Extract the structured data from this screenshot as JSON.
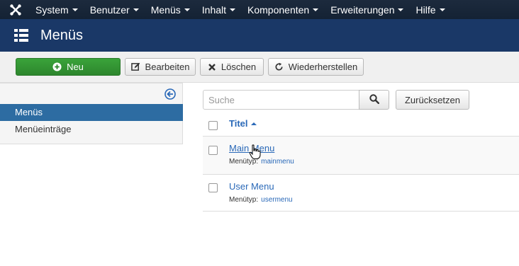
{
  "navbar": {
    "logo_icon": "joomla-logo-icon",
    "items": [
      {
        "label": "System"
      },
      {
        "label": "Benutzer"
      },
      {
        "label": "Menüs"
      },
      {
        "label": "Inhalt"
      },
      {
        "label": "Komponenten"
      },
      {
        "label": "Erweiterungen"
      },
      {
        "label": "Hilfe"
      }
    ]
  },
  "header": {
    "icon": "list-icon",
    "title": "Menüs"
  },
  "toolbar": {
    "new_label": "Neu",
    "edit_label": "Bearbeiten",
    "delete_label": "Löschen",
    "restore_label": "Wiederherstellen"
  },
  "sidebar": {
    "items": [
      {
        "label": "Menüs",
        "active": true
      },
      {
        "label": "Menüeinträge",
        "active": false
      }
    ]
  },
  "search": {
    "placeholder": "Suche",
    "value": "",
    "reset_label": "Zurücksetzen"
  },
  "table": {
    "title_header": "Titel",
    "rows": [
      {
        "title": "Main Menu",
        "type_label": "Menütyp:",
        "type_value": "mainmenu"
      },
      {
        "title": "User Menu",
        "type_label": "Menütyp:",
        "type_value": "usermenu"
      }
    ]
  },
  "colors": {
    "navbar_bg": "#142234",
    "header_bg": "#1a3867",
    "new_button": "#2d862d",
    "active_item": "#2d6ca2",
    "link": "#2a69b8"
  }
}
